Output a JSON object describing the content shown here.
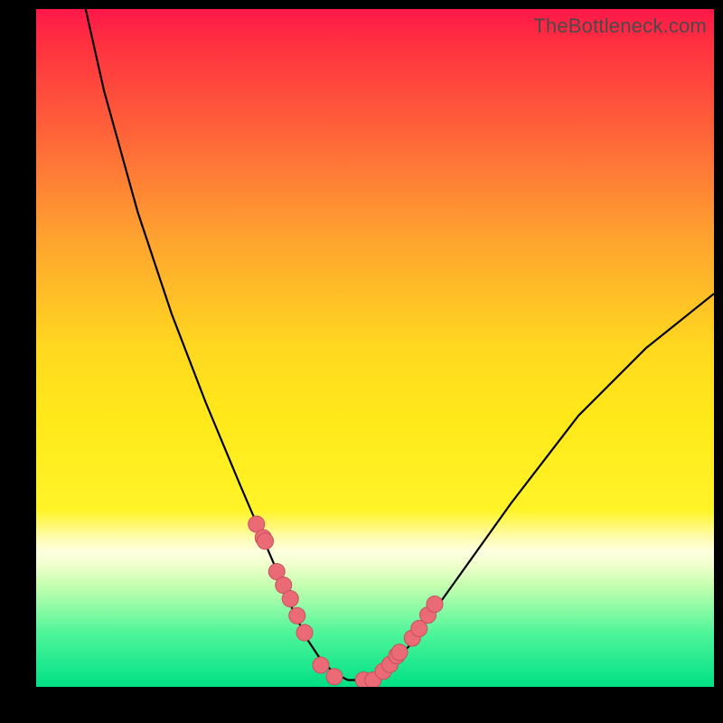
{
  "watermark": "TheBottleneck.com",
  "colors": {
    "background": "#000000",
    "curve_stroke": "#000000",
    "marker_fill": "#ea6a76",
    "marker_stroke": "#c94f5f",
    "gradient_top": "#ff184a",
    "gradient_bottom": "#00e085"
  },
  "chart_data": {
    "type": "line",
    "title": "",
    "xlabel": "",
    "ylabel": "",
    "xlim": [
      0,
      100
    ],
    "ylim": [
      0,
      100
    ],
    "grid": false,
    "legend": false,
    "series": [
      {
        "name": "bottleneck-curve",
        "x": [
          7.3,
          10,
          15,
          20,
          25,
          30,
          33,
          36,
          38,
          40,
          42,
          44,
          46,
          48,
          50,
          52,
          55,
          60,
          65,
          70,
          80,
          90,
          100
        ],
        "values": [
          100,
          88,
          70,
          55,
          42,
          30,
          23,
          16,
          11,
          7,
          4,
          2,
          1,
          1,
          1,
          3,
          6,
          13,
          20,
          27,
          40,
          50,
          58
        ]
      }
    ],
    "markers": {
      "name": "highlight-points",
      "x": [
        32.5,
        33.5,
        33.8,
        35.5,
        36.5,
        37.5,
        38.5,
        39.6,
        42,
        44,
        48.3,
        49.7,
        51.2,
        52.2,
        53.2,
        53.6,
        55.5,
        56.5,
        57.8,
        58.8
      ],
      "values": [
        24,
        22,
        21.5,
        17,
        15,
        13,
        10.5,
        8,
        3.2,
        1.5,
        1,
        1,
        2.3,
        3.3,
        4.6,
        5.1,
        7.2,
        8.6,
        10.6,
        12.2
      ]
    }
  }
}
